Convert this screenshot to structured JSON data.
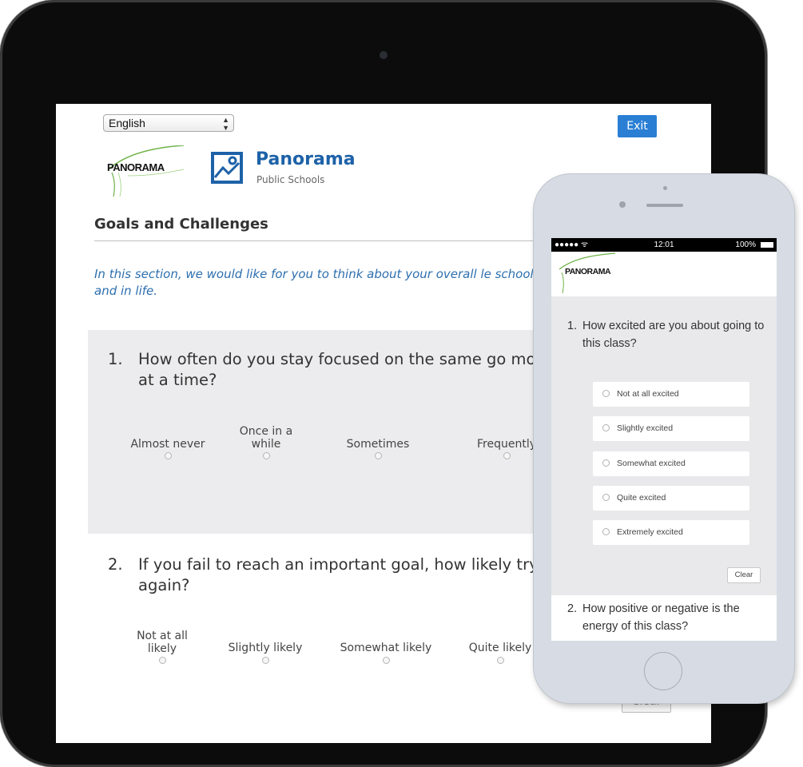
{
  "tablet": {
    "language_select": {
      "value": "English"
    },
    "exit_label": "Exit",
    "logo_text": "PANORAMA",
    "school": {
      "name": "Panorama",
      "subtitle": "Public Schools"
    },
    "section_title": "Goals and Challenges",
    "intro": "In this section, we would like for you to think about your overall le school and in life.",
    "questions": [
      {
        "number": "1.",
        "text": "How often do you stay focused on the same go months at a time?",
        "options": [
          "Almost never",
          "Once in a while",
          "Sometimes",
          "Frequently"
        ]
      },
      {
        "number": "2.",
        "text": "If you fail to reach an important goal, how likely try again?",
        "options": [
          "Not at all likely",
          "Slightly likely",
          "Somewhat likely",
          "Quite likely"
        ]
      }
    ],
    "clear_label": "Clear"
  },
  "phone": {
    "status": {
      "left": "●●●●● ᯤ",
      "time": "12:01",
      "battery": "100%"
    },
    "logo_text": "PANORAMA",
    "question1": {
      "number": "1.",
      "text": "How excited are you about going to this class?",
      "options": [
        "Not at all excited",
        "Slightly excited",
        "Somewhat excited",
        "Quite excited",
        "Extremely excited"
      ]
    },
    "clear_label": "Clear",
    "question2": {
      "number": "2.",
      "text": "How positive or negative is the energy of this class?"
    }
  },
  "colors": {
    "accent_blue": "#2a7fd4",
    "school_blue": "#1d62a8",
    "intro_blue": "#2d6fae",
    "panel_gray": "#ececee"
  },
  "icons": {
    "language_arrows": "up-down-arrows-icon",
    "school": "image-frame-icon",
    "radio": "radio-empty-icon",
    "battery": "battery-icon"
  }
}
